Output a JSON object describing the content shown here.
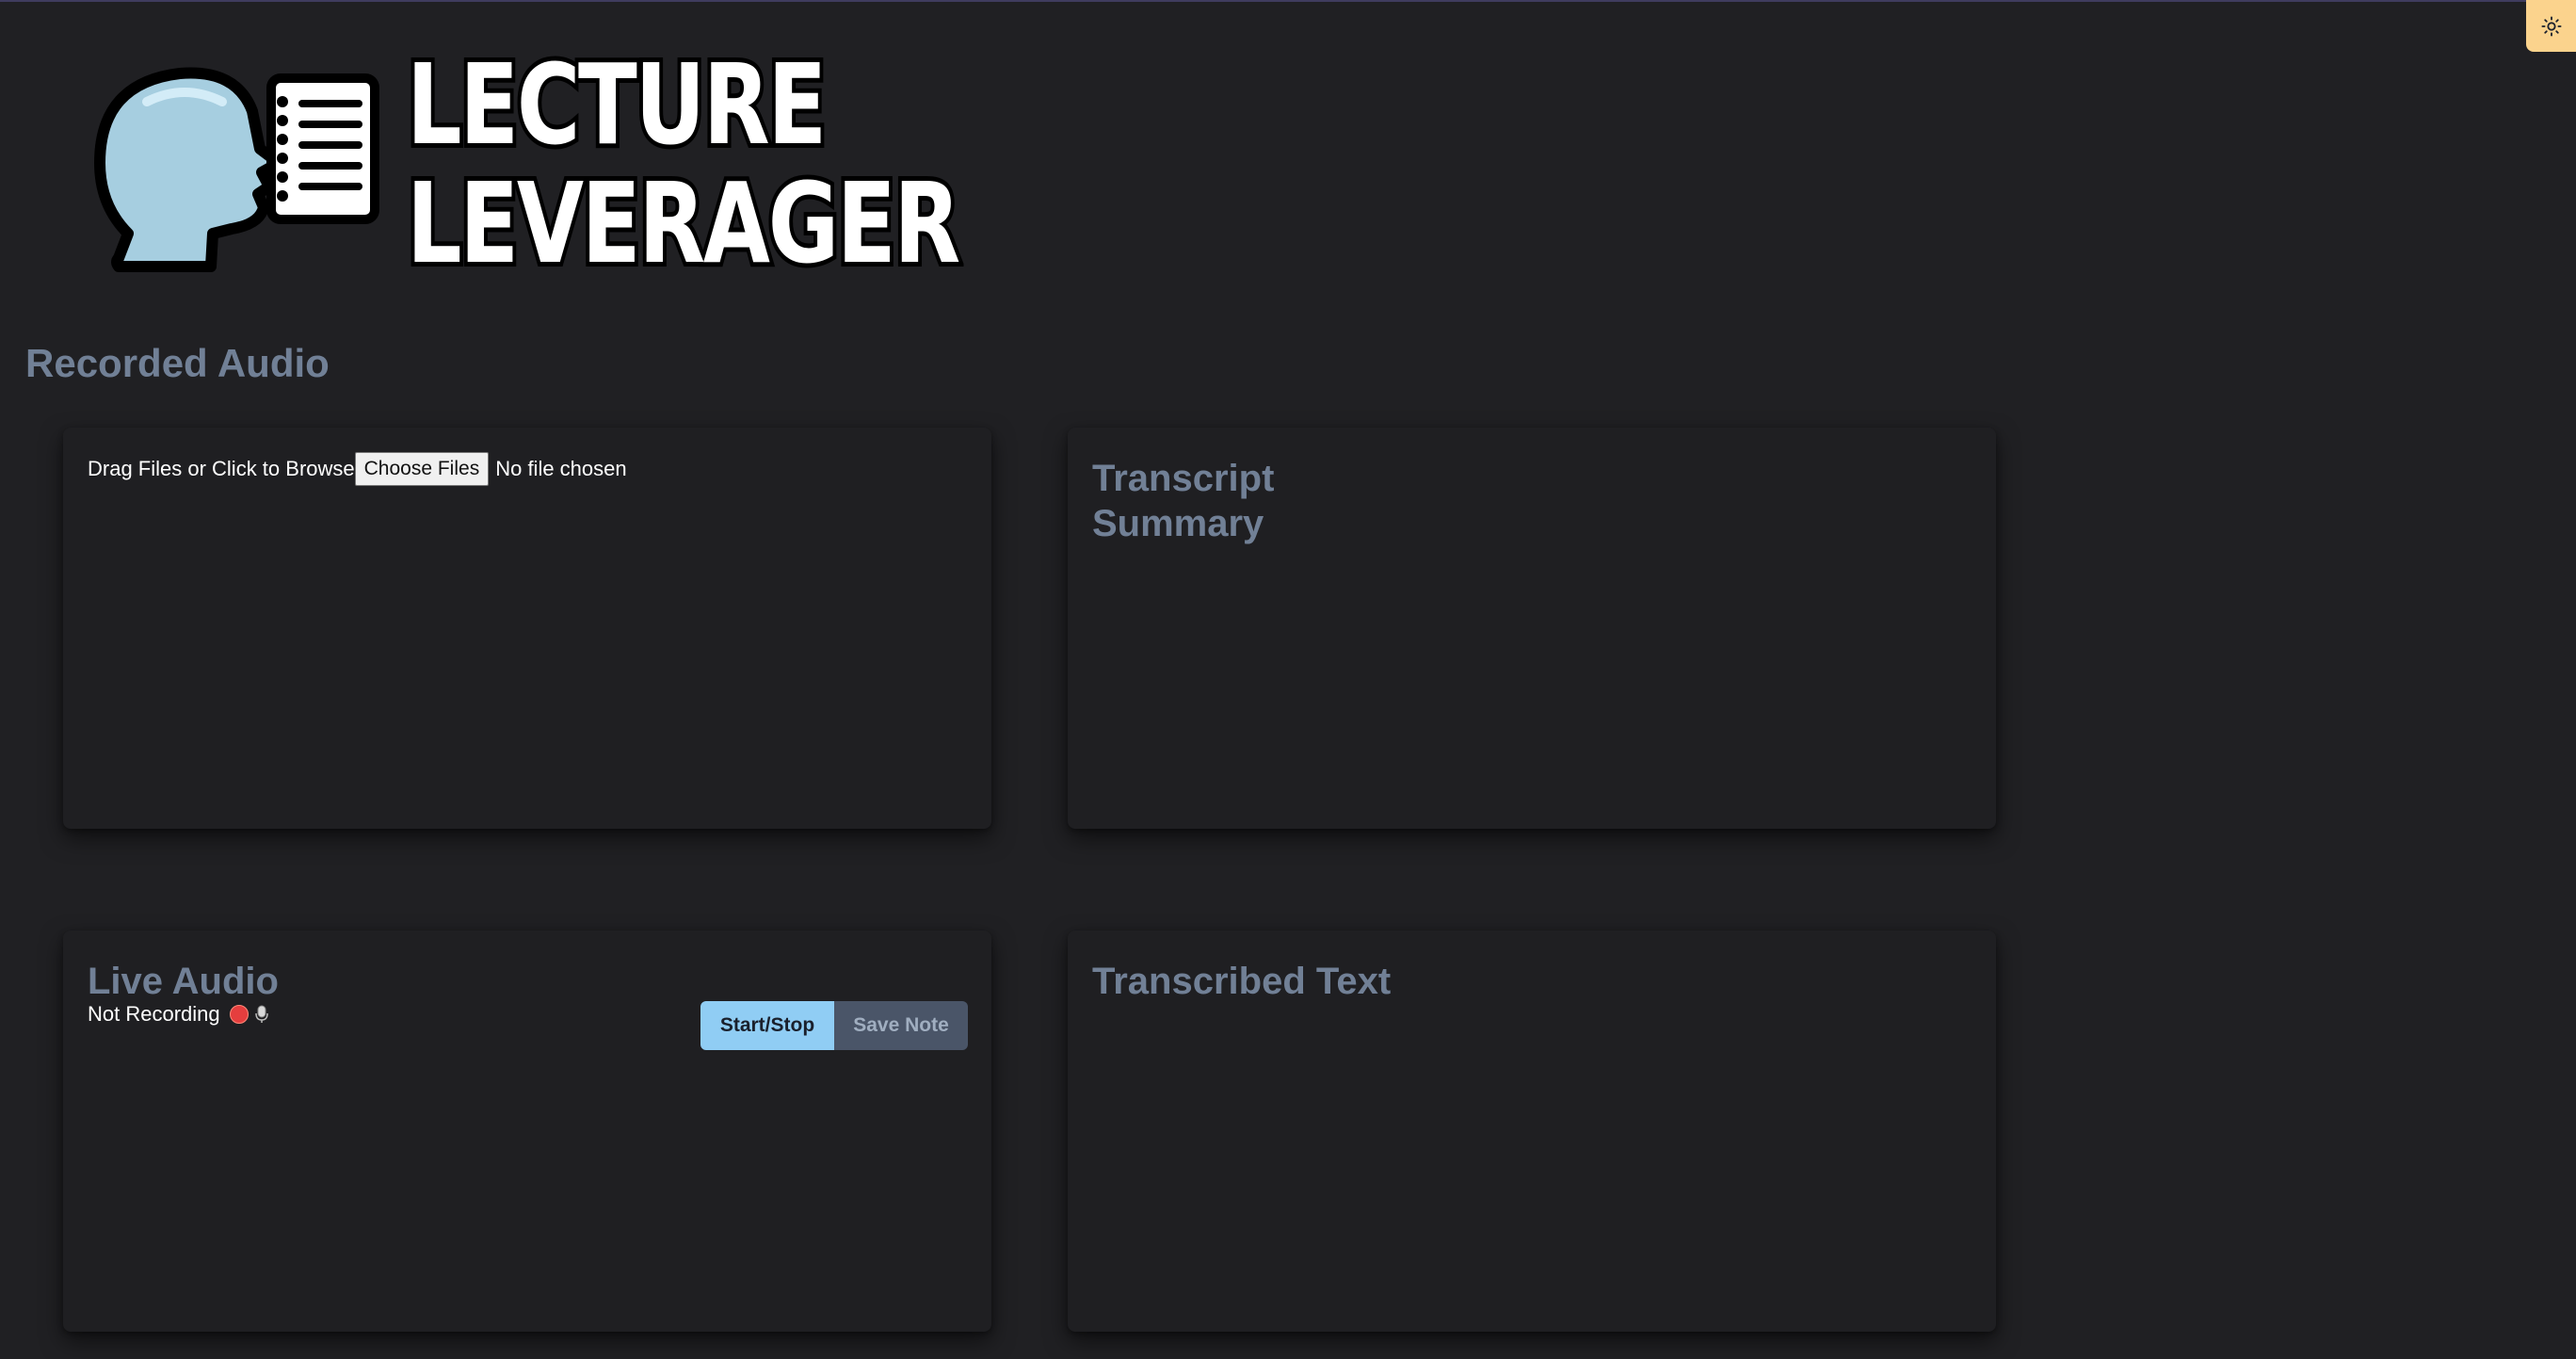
{
  "app": {
    "logo_line1": "LECTURE",
    "logo_line2": "LEVERAGER",
    "theme_toggle_icon": "sun-icon"
  },
  "recorded_audio": {
    "section_title": "Recorded Audio",
    "drop_label": "Drag Files or Click to Browse",
    "choose_button": "Choose Files",
    "file_status": "No file chosen"
  },
  "summary": {
    "title_line1": "Transcript",
    "title_line2": "Summary"
  },
  "live_audio": {
    "title": "Live Audio",
    "status": "Not Recording",
    "start_stop_label": "Start/Stop",
    "save_note_label": "Save Note"
  },
  "transcribed": {
    "title": "Transcribed Text"
  },
  "colors": {
    "background": "#202023",
    "card": "#1f1f22",
    "heading": "#718096",
    "accent_button": "#90cdf4",
    "disabled_button": "#4a5568",
    "toggle": "#fbd38d",
    "record_dot": "#e53e3e"
  }
}
